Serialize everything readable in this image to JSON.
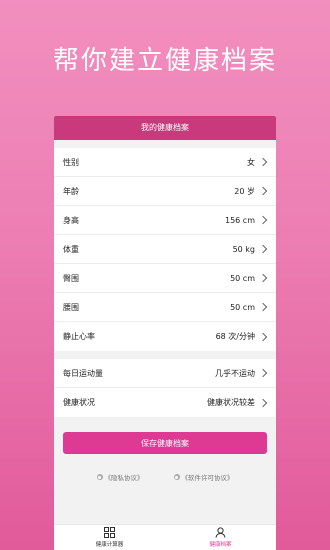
{
  "hero": {
    "title": "帮你建立健康档案"
  },
  "header": {
    "title": "我的健康档案"
  },
  "profile": [
    {
      "label": "性别",
      "value": "女"
    },
    {
      "label": "年龄",
      "value": "20 岁"
    },
    {
      "label": "身高",
      "value": "156 cm"
    },
    {
      "label": "体重",
      "value": "50 kg"
    },
    {
      "label": "臀围",
      "value": "50 cm"
    },
    {
      "label": "腰围",
      "value": "50 cm"
    },
    {
      "label": "静止心率",
      "value": "68 次/分钟"
    }
  ],
  "extra": [
    {
      "label": "每日运动量",
      "value": "几乎不运动"
    },
    {
      "label": "健康状况",
      "value": "健康状况较差"
    }
  ],
  "save_label": "保存健康档案",
  "links": {
    "privacy": "《隐私协议》",
    "license": "《软件许可协议》"
  },
  "tabs": [
    {
      "label": "健康计算器",
      "icon": "grid-icon"
    },
    {
      "label": "健康档案",
      "icon": "user-icon"
    }
  ],
  "colors": {
    "accent": "#de3a93",
    "header": "#c93a7d"
  }
}
